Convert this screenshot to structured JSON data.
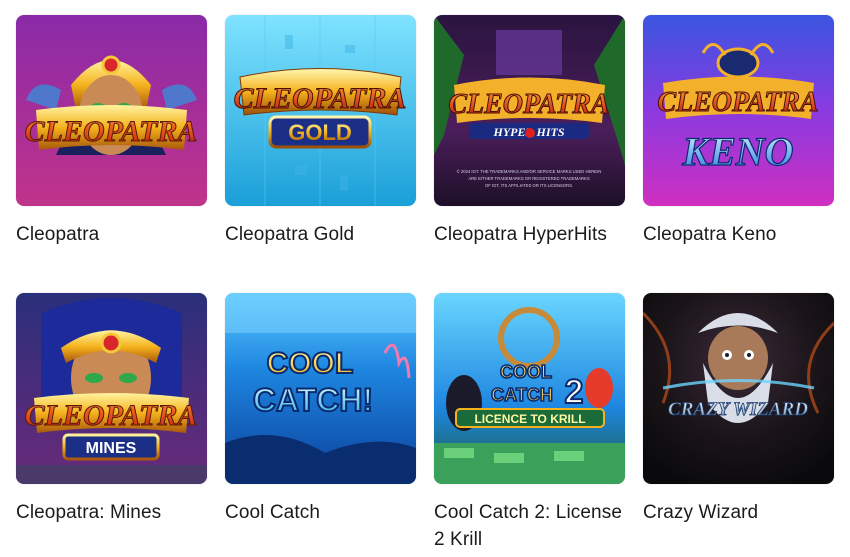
{
  "games": [
    {
      "title": "Cleopatra",
      "logo": "CLEOPATRA",
      "sub": ""
    },
    {
      "title": "Cleopatra Gold",
      "logo": "CLEOPATRA",
      "sub": "GOLD"
    },
    {
      "title": "Cleopatra HyperHits",
      "logo": "CLEOPATRA",
      "sub": "HYPER HITS",
      "fineprint": "© 2024 IGT. THE TRADEMARKS AND/OR SERVICE MARKS USED HEREIN ARE EITHER TRADEMARKS OR REGISTERED TRADEMARKS OF IGT, ITS AFFILIATES OR ITS LICENSORS."
    },
    {
      "title": "Cleopatra Keno",
      "logo": "CLEOPATRA",
      "sub": "KENO"
    },
    {
      "title": "Cleopatra: Mines",
      "logo": "CLEOPATRA",
      "sub": "MINES"
    },
    {
      "title": "Cool Catch",
      "logo": "COOL",
      "sub": "CATCH!"
    },
    {
      "title": "Cool Catch 2: License 2 Krill",
      "logo": "COOL CATCH 2",
      "sub": "LICENCE TO KRILL"
    },
    {
      "title": "Crazy Wizard",
      "logo": "CRAZY WIZARD",
      "sub": ""
    }
  ]
}
